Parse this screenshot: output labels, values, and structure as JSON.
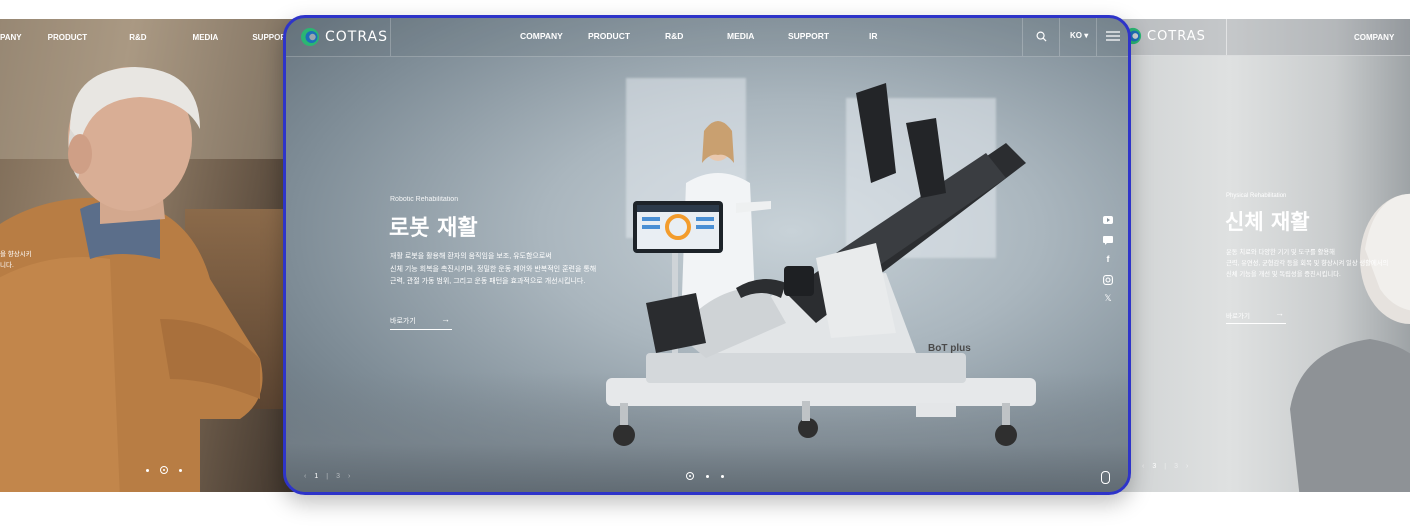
{
  "left_slide": {
    "nav": [
      "PANY",
      "PRODUCT",
      "R&D",
      "MEDIA",
      "SUPPORT"
    ],
    "desc": [
      "을 향상시키",
      "니다."
    ],
    "dots": 3
  },
  "main": {
    "logo": "COTRAS",
    "nav": [
      "COMPANY",
      "PRODUCT",
      "R&D",
      "MEDIA",
      "SUPPORT",
      "IR"
    ],
    "lang": "KO ▾",
    "subtitle": "Robotic Rehabilitation",
    "title": "로봇 재활",
    "desc": [
      "재활 로봇을 활용해 환자의 움직임을 보조, 유도함으로써",
      "신체 기능 회복을 촉진시키며, 정밀한 운동 제어와 반복적인 훈련을 통해",
      "근력, 관절 가동 범위, 그리고 운동 패턴을 효과적으로 개선시킵니다."
    ],
    "link_label": "바로가기",
    "pager": {
      "current": "1",
      "total": "3"
    },
    "device_brand": "BoT plus",
    "icons": [
      "youtube-icon",
      "chat-icon",
      "facebook-icon",
      "instagram-icon",
      "x-icon"
    ]
  },
  "right_slide": {
    "logo": "COTRAS",
    "nav": [
      "COMPANY"
    ],
    "subtitle": "Physical Rehabilitation",
    "title": "신체 재활",
    "desc": [
      "운동 치료와 다양한 기기 및 도구를 활용해",
      "근력, 유연성, 균형감각 등을 회복 및 향상시켜 일상 생활에서의",
      "신체 기능을 개선 및 독립성을 증진시킵니다."
    ],
    "link_label": "바로가기",
    "pager": {
      "current": "3",
      "total": "3"
    }
  },
  "colors": {
    "frame": "#2e34c9",
    "accent_green": "#2bb673",
    "accent_blue": "#1d6fb8"
  }
}
